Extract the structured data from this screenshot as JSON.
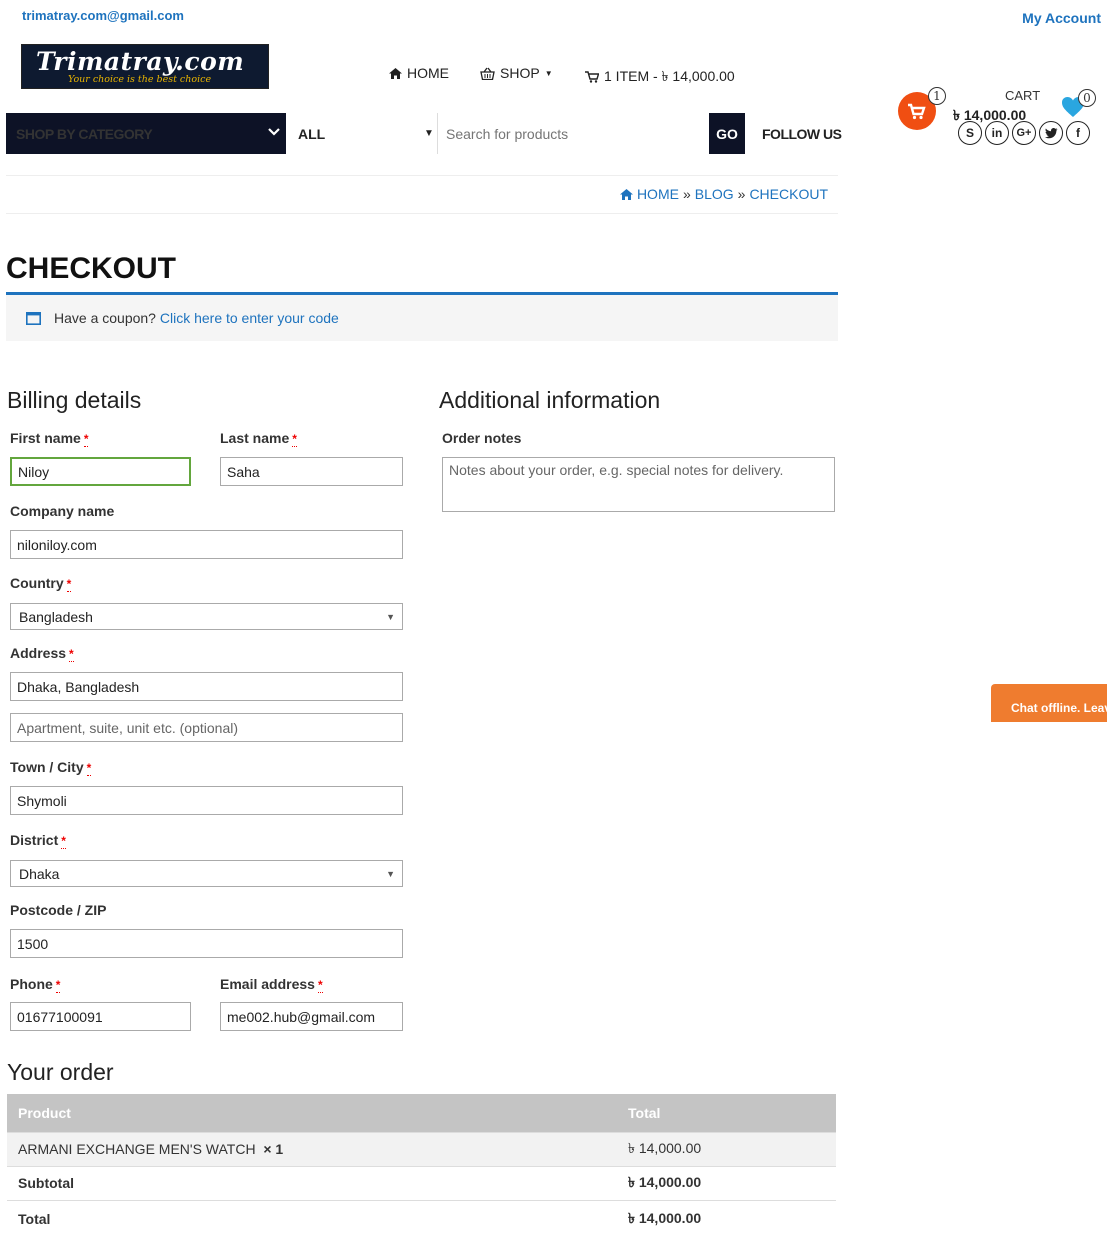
{
  "topbar": {
    "email": "trimatray.com@gmail.com",
    "account": "My Account"
  },
  "logo": {
    "name": "Trimatray.com",
    "tagline": "Your choice is the best choice"
  },
  "nav": {
    "home": "HOME",
    "shop": "SHOP",
    "cart_summary": "1 ITEM - ৳ 14,000.00"
  },
  "header_cart": {
    "count": "1",
    "label": "CART",
    "total": "৳ 14,000.00",
    "wishlist_count": "0",
    "accent": "#f04e12"
  },
  "menubar": {
    "shop_by_category": "SHOP BY CATEGORY",
    "category_select": "ALL",
    "search_placeholder": "Search for products",
    "go": "GO",
    "follow_us": "FOLLOW US",
    "socials": [
      "skype-icon",
      "linkedin-icon",
      "google-plus-icon",
      "twitter-icon",
      "facebook-icon"
    ]
  },
  "breadcrumb": {
    "home": "HOME",
    "blog": "BLOG",
    "current": "CHECKOUT",
    "sep": "»"
  },
  "page": {
    "title": "CHECKOUT"
  },
  "coupon": {
    "text": "Have a coupon?",
    "link": "Click here to enter your code"
  },
  "billing": {
    "heading": "Billing details",
    "required_mark": "*",
    "first_name": {
      "label": "First name",
      "value": "Niloy"
    },
    "last_name": {
      "label": "Last name",
      "value": "Saha"
    },
    "company": {
      "label": "Company name",
      "value": "niloniloy.com"
    },
    "country": {
      "label": "Country",
      "value": "Bangladesh"
    },
    "address": {
      "label": "Address",
      "value": "Dhaka, Bangladesh",
      "placeholder2": "Apartment, suite, unit etc. (optional)"
    },
    "city": {
      "label": "Town / City",
      "value": "Shymoli"
    },
    "district": {
      "label": "District",
      "value": "Dhaka"
    },
    "postcode": {
      "label": "Postcode / ZIP",
      "value": "1500"
    },
    "phone": {
      "label": "Phone",
      "value": "01677100091"
    },
    "email": {
      "label": "Email address",
      "value": "me002.hub@gmail.com"
    }
  },
  "additional": {
    "heading": "Additional information",
    "notes_label": "Order notes",
    "notes_placeholder": "Notes about your order, e.g. special notes for delivery."
  },
  "order": {
    "heading": "Your order",
    "col_product": "Product",
    "col_total": "Total",
    "item_name": "ARMANI EXCHANGE MEN'S WATCH",
    "item_qty": "× 1",
    "item_total": "৳ 14,000.00",
    "subtotal_label": "Subtotal",
    "subtotal": "৳ 14,000.00",
    "total_label": "Total",
    "total": "৳ 14,000.00"
  },
  "chat": {
    "text": "Chat offline. Leave a message"
  }
}
